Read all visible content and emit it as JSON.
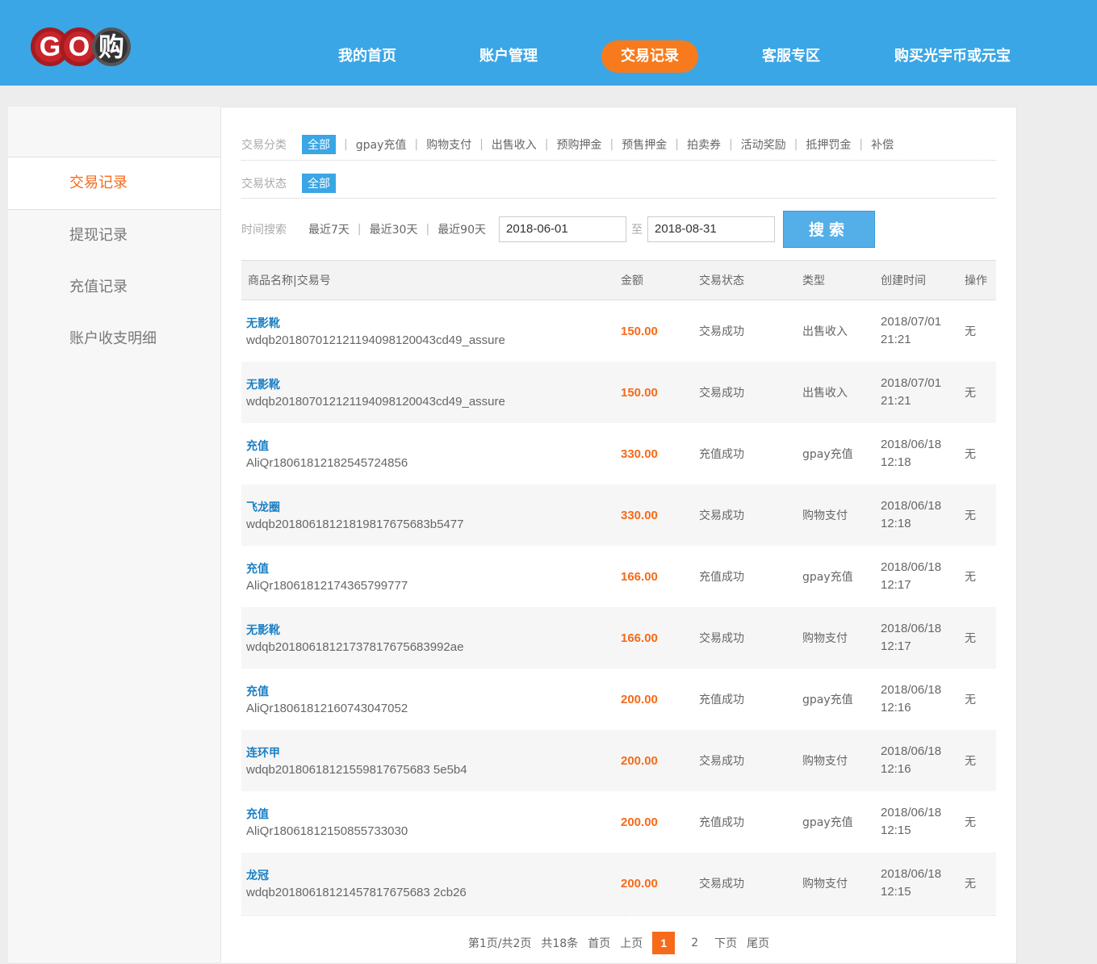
{
  "header": {
    "logo_text": "GO",
    "logo_char": "购",
    "nav": [
      {
        "label": "我的首页"
      },
      {
        "label": "账户管理"
      },
      {
        "label": "交易记录"
      },
      {
        "label": "客服专区"
      },
      {
        "label": "购买光宇币或元宝"
      }
    ]
  },
  "sidebar": {
    "items": [
      {
        "label": "交易记录"
      },
      {
        "label": "提现记录"
      },
      {
        "label": "充值记录"
      },
      {
        "label": "账户收支明细"
      }
    ]
  },
  "filters": {
    "category_label": "交易分类",
    "categories": [
      "全部",
      "gpay充值",
      "购物支付",
      "出售收入",
      "预购押金",
      "预售押金",
      "拍卖券",
      "活动奖励",
      "抵押罚金",
      "补偿"
    ],
    "status_label": "交易状态",
    "status_all": "全部",
    "time_label": "时间搜索",
    "time_options": [
      "最近7天",
      "最近30天",
      "最近90天"
    ],
    "date_from": "2018-06-01",
    "date_to_sep": "至",
    "date_to": "2018-08-31",
    "search_label": "搜索"
  },
  "table": {
    "headers": [
      "商品名称|交易号",
      "金额",
      "交易状态",
      "类型",
      "创建时间",
      "操作"
    ],
    "rows": [
      {
        "name": "无影靴",
        "id": "wdqb201807012121194098120043cd49_assure",
        "amount": "150.00",
        "status": "交易成功",
        "type": "出售收入",
        "date": "2018/07/01",
        "time": "21:21",
        "op": "无"
      },
      {
        "name": "无影靴",
        "id": "wdqb201807012121194098120043cd49_assure",
        "amount": "150.00",
        "status": "交易成功",
        "type": "出售收入",
        "date": "2018/07/01",
        "time": "21:21",
        "op": "无"
      },
      {
        "name": "充值",
        "id": "AliQr18061812182545724856",
        "amount": "330.00",
        "status": "充值成功",
        "type": "gpay充值",
        "date": "2018/06/18",
        "time": "12:18",
        "op": "无"
      },
      {
        "name": "飞龙圈",
        "id": "wdqb20180618121819817675683b5477",
        "amount": "330.00",
        "status": "交易成功",
        "type": "购物支付",
        "date": "2018/06/18",
        "time": "12:18",
        "op": "无"
      },
      {
        "name": "充值",
        "id": "AliQr18061812174365799777",
        "amount": "166.00",
        "status": "充值成功",
        "type": "gpay充值",
        "date": "2018/06/18",
        "time": "12:17",
        "op": "无"
      },
      {
        "name": "无影靴",
        "id": "wdqb20180618121737817675683992ae",
        "amount": "166.00",
        "status": "交易成功",
        "type": "购物支付",
        "date": "2018/06/18",
        "time": "12:17",
        "op": "无"
      },
      {
        "name": "充值",
        "id": "AliQr18061812160743047052",
        "amount": "200.00",
        "status": "充值成功",
        "type": "gpay充值",
        "date": "2018/06/18",
        "time": "12:16",
        "op": "无"
      },
      {
        "name": "连环甲",
        "id": "wdqb20180618121559817675683 5e5b4",
        "amount": "200.00",
        "status": "交易成功",
        "type": "购物支付",
        "date": "2018/06/18",
        "time": "12:16",
        "op": "无"
      },
      {
        "name": "充值",
        "id": "AliQr18061812150855733030",
        "amount": "200.00",
        "status": "充值成功",
        "type": "gpay充值",
        "date": "2018/06/18",
        "time": "12:15",
        "op": "无"
      },
      {
        "name": "龙冠",
        "id": "wdqb20180618121457817675683 2cb26",
        "amount": "200.00",
        "status": "交易成功",
        "type": "购物支付",
        "date": "2018/06/18",
        "time": "12:15",
        "op": "无"
      }
    ]
  },
  "pager": {
    "info": "第1页/共2页",
    "total": "共18条",
    "first": "首页",
    "prev": "上页",
    "pages": [
      "1",
      "2"
    ],
    "next": "下页",
    "last": "尾页"
  }
}
